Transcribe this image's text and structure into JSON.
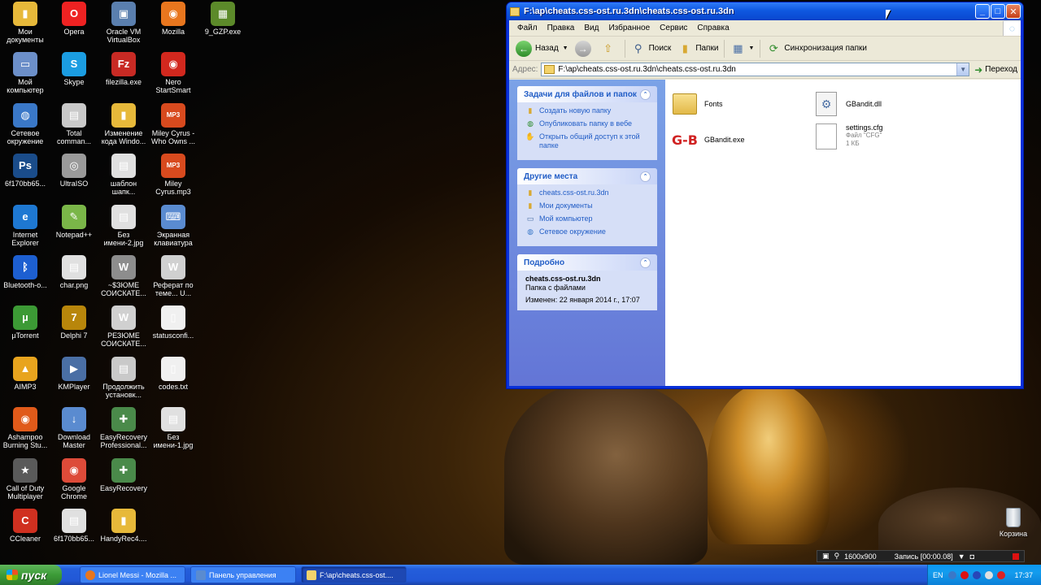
{
  "desktop": {
    "icons": [
      {
        "label": "Мои документы",
        "glyph": "▮",
        "color": "#e7b93a"
      },
      {
        "label": "Opera",
        "glyph": "O",
        "color": "#e22"
      },
      {
        "label": "Oracle VM VirtualBox",
        "glyph": "▣",
        "color": "#5a7fae"
      },
      {
        "label": "Mozilla",
        "glyph": "◉",
        "color": "#e8761e"
      },
      {
        "label": "9_GZP.exe",
        "glyph": "▦",
        "color": "#5c8a2a"
      },
      {
        "label": "Мой компьютер",
        "glyph": "▭",
        "color": "#6c8fc9"
      },
      {
        "label": "Skype",
        "glyph": "S",
        "color": "#1b9de2"
      },
      {
        "label": "filezilla.exe",
        "glyph": "Fz",
        "color": "#c82a24"
      },
      {
        "label": "Nero StartSmart",
        "glyph": "◉",
        "color": "#d2281e"
      },
      {
        "label": "Сетевое окружение",
        "glyph": "◍",
        "color": "#3a78c8"
      },
      {
        "label": "Total comman...",
        "glyph": "▤",
        "color": "#c9c9c9"
      },
      {
        "label": "Изменение кода Windo...",
        "glyph": "▮",
        "color": "#e7b93a"
      },
      {
        "label": "Miley Cyrus - Who Owns ...",
        "glyph": "MP3",
        "color": "#d84a1e"
      },
      {
        "label": "6f170bb65...",
        "glyph": "Ps",
        "color": "#1a4c8a"
      },
      {
        "label": "UltraISO",
        "glyph": "◎",
        "color": "#9a9a9a"
      },
      {
        "label": "шаблон шапк...",
        "glyph": "▤",
        "color": "#e0e0e0"
      },
      {
        "label": "Miley Cyrus.mp3",
        "glyph": "MP3",
        "color": "#d84a1e"
      },
      {
        "label": "Internet Explorer",
        "glyph": "e",
        "color": "#1e78d2"
      },
      {
        "label": "Notepad++",
        "glyph": "✎",
        "color": "#7ab648"
      },
      {
        "label": "Без имени-2.jpg",
        "glyph": "▤",
        "color": "#e0e0e0"
      },
      {
        "label": "Экранная клавиатура",
        "glyph": "⌨",
        "color": "#5a8bd0"
      },
      {
        "label": "Bluetooth-о...",
        "glyph": "ᛒ",
        "color": "#1d5fd1"
      },
      {
        "label": "char.png",
        "glyph": "▤",
        "color": "#e0e0e0"
      },
      {
        "label": "~$ЗЮМЕ СОИСКАТЕ...",
        "glyph": "W",
        "color": "#8d8d8d"
      },
      {
        "label": "Реферат по теме... U...",
        "glyph": "W",
        "color": "#d0d0d0"
      },
      {
        "label": "µTorrent",
        "glyph": "µ",
        "color": "#3c9a35"
      },
      {
        "label": "Delphi 7",
        "glyph": "7",
        "color": "#b8860b"
      },
      {
        "label": "РЕЗЮМЕ СОИСКАТЕ...",
        "glyph": "W",
        "color": "#d0d0d0"
      },
      {
        "label": "statusconfi...",
        "glyph": "▯",
        "color": "#f0f0f0"
      },
      {
        "label": "AIMP3",
        "glyph": "▲",
        "color": "#e8a41e"
      },
      {
        "label": "KMPlayer",
        "glyph": "▶",
        "color": "#4a6fa5"
      },
      {
        "label": "Продолжить установк...",
        "glyph": "▤",
        "color": "#c9c9c9"
      },
      {
        "label": "codes.txt",
        "glyph": "▯",
        "color": "#f0f0f0"
      },
      {
        "label": "Ashampoo Burning Stu...",
        "glyph": "◉",
        "color": "#e05a1a"
      },
      {
        "label": "Download Master",
        "glyph": "↓",
        "color": "#5a8bd0"
      },
      {
        "label": "EasyRecovery Professional...",
        "glyph": "✚",
        "color": "#4a8a4a"
      },
      {
        "label": "Без имени-1.jpg",
        "glyph": "▤",
        "color": "#e0e0e0"
      },
      {
        "label": "Call of Duty Multiplayer",
        "glyph": "★",
        "color": "#5a5a5a"
      },
      {
        "label": "Google Chrome",
        "glyph": "◉",
        "color": "#dd4b39"
      },
      {
        "label": "EasyRecovery",
        "glyph": "✚",
        "color": "#4a8a4a"
      },
      {
        "label": "CCleaner",
        "glyph": "C",
        "color": "#d03020"
      },
      {
        "label": "6f170bb65...",
        "glyph": "▤",
        "color": "#e0e0e0"
      },
      {
        "label": "HandyRec4....",
        "glyph": "▮",
        "color": "#e7b93a"
      }
    ],
    "trash_label": "Корзина"
  },
  "window": {
    "title": "F:\\ap\\cheats.css-ost.ru.3dn\\cheats.css-ost.ru.3dn",
    "menu": [
      "Файл",
      "Правка",
      "Вид",
      "Избранное",
      "Сервис",
      "Справка"
    ],
    "toolbar": {
      "back": "Назад",
      "search": "Поиск",
      "folders": "Папки",
      "sync": "Синхронизация папки"
    },
    "address": {
      "label": "Адрес:",
      "value": "F:\\ap\\cheats.css-ost.ru.3dn\\cheats.css-ost.ru.3dn",
      "go": "Переход"
    },
    "tasks_panel": {
      "title": "Задачи для файлов и папок",
      "links": [
        "Создать новую папку",
        "Опубликовать папку в вебе",
        "Открыть общий доступ к этой папке"
      ]
    },
    "places_panel": {
      "title": "Другие места",
      "links": [
        "cheats.css-ost.ru.3dn",
        "Мои документы",
        "Мой компьютер",
        "Сетевое окружение"
      ]
    },
    "details_panel": {
      "title": "Подробно",
      "name": "cheats.css-ost.ru.3dn",
      "type": "Папка с файлами",
      "modified": "Изменен: 22 января 2014 г., 17:07"
    },
    "files": [
      {
        "name": "Fonts",
        "kind": "folder"
      },
      {
        "name": "GBandit.dll",
        "kind": "dll"
      },
      {
        "name": "GBandit.exe",
        "kind": "exe",
        "icon_text": "G-B"
      },
      {
        "name": "settings.cfg",
        "kind": "cfg",
        "type": "Файл \"CFG\"",
        "size": "1 КБ"
      }
    ]
  },
  "recorder": {
    "resolution": "1600x900",
    "status": "Запись [00:00.08]"
  },
  "taskbar": {
    "start": "пуск",
    "tasks": [
      {
        "label": "Lionel Messi - Mozilla ...",
        "color": "#e8761e"
      },
      {
        "label": "Панель управления",
        "color": "#5a8bd0"
      },
      {
        "label": "F:\\ap\\cheats.css-ost....",
        "color": "#f3d36c"
      }
    ],
    "lang": "EN",
    "clock": "17:37"
  }
}
